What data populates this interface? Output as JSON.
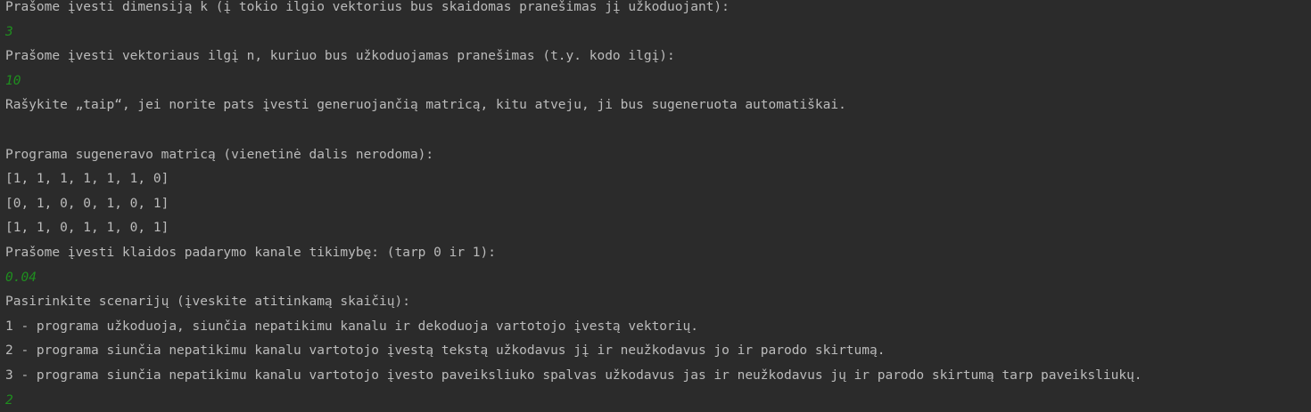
{
  "console": {
    "prompt_dimension": "Prašome įvesti dimensiją k (į tokio ilgio vektorius bus skaidomas pranešimas jį užkoduojant):",
    "input_dimension": "3",
    "prompt_length": "Prašome įvesti vektoriaus ilgį n, kuriuo bus užkoduojamas pranešimas (t.y. kodo ilgį):",
    "input_length": "10",
    "prompt_matrix_choice": "Rašykite „taip“, jei norite pats įvesti generuojančią matricą, kitu atveju, ji bus sugeneruota automatiškai.",
    "input_matrix_choice": "",
    "matrix_header": "Programa sugeneravo matricą (vienetinė dalis nerodoma):",
    "matrix_rows": [
      "[1, 1, 1, 1, 1, 1, 0]",
      "[0, 1, 0, 0, 1, 0, 1]",
      "[1, 1, 0, 1, 1, 0, 1]"
    ],
    "prompt_probability": "Prašome įvesti klaidos padarymo kanale tikimybę: (tarp 0 ir 1):",
    "input_probability": "0.04",
    "prompt_scenario": "Pasirinkite scenarijų (įveskite atitinkamą skaičių):",
    "scenario_1": "1 - programa užkoduoja, siunčia nepatikimu kanalu ir dekoduoja vartotojo įvestą vektorių.",
    "scenario_2": "2 - programa siunčia nepatikimu kanalu vartotojo įvestą tekstą užkodavus jį ir neužkodavus jo ir parodo skirtumą.",
    "scenario_3": "3 - programa siunčia nepatikimu kanalu vartotojo įvesto paveiksliuko spalvas užkodavus jas ir neužkodavus jų ir parodo skirtumą tarp paveiksliukų.",
    "input_scenario": "2"
  },
  "colors": {
    "background": "#2b2b2b",
    "output_text": "#bbbbbb",
    "user_input": "#1f8f1f"
  }
}
